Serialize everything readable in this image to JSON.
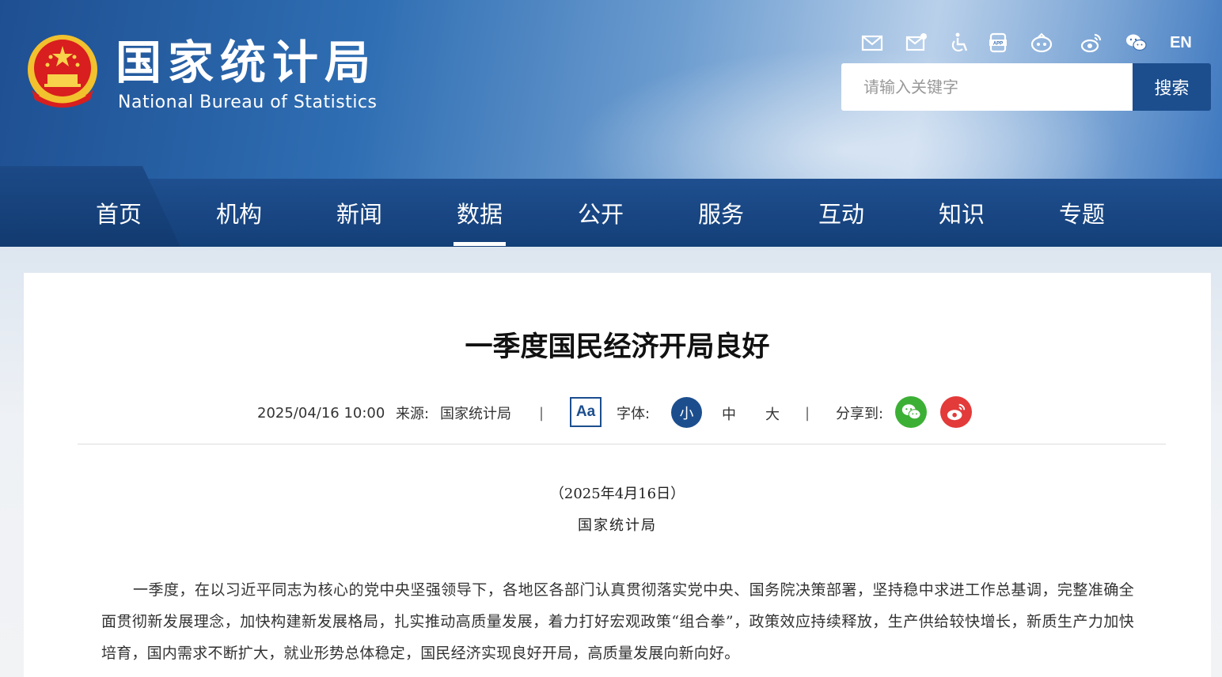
{
  "header": {
    "site_name_cn": "国家统计局",
    "site_name_en": "National Bureau of Statistics",
    "tools": [
      {
        "icon": "mail-icon"
      },
      {
        "icon": "mail-settings-icon"
      },
      {
        "icon": "accessibility-icon"
      },
      {
        "icon": "app-icon"
      },
      {
        "icon": "weibo-face-icon"
      },
      {
        "icon": "weibo-icon"
      },
      {
        "icon": "wechat-icon"
      }
    ],
    "lang_label": "EN",
    "search": {
      "placeholder": "请输入关键字",
      "button_label": "搜索"
    }
  },
  "nav": {
    "items": [
      "首页",
      "机构",
      "新闻",
      "数据",
      "公开",
      "服务",
      "互动",
      "知识",
      "专题"
    ],
    "active": "数据"
  },
  "article": {
    "title": "一季度国民经济开局良好",
    "datetime": "2025/04/16 10:00",
    "source_label": "来源:",
    "source": "国家统计局",
    "separator": "|",
    "aa_label": "Aa",
    "font_label": "字体:",
    "font_sizes": [
      "小",
      "中",
      "大"
    ],
    "share_label": "分享到:",
    "date_line": "（2025年4月16日）",
    "author_line": "国家统计局",
    "paragraph": "一季度，在以习近平同志为核心的党中央坚强领导下，各地区各部门认真贯彻落实党中央、国务院决策部署，坚持稳中求进工作总基调，完整准确全面贯彻新发展理念，加快构建新发展格局，扎实推动高质量发展，着力打好宏观政策“组合拳”，政策效应持续释放，生产供给较快增长，新质生产力加快培育，国内需求不断扩大，就业形势总体稳定，国民经济实现良好开局，高质量发展向新向好。"
  },
  "colors": {
    "primary": "#1c4e8e",
    "wechat": "#3cb035",
    "weibo": "#e33a3a"
  }
}
